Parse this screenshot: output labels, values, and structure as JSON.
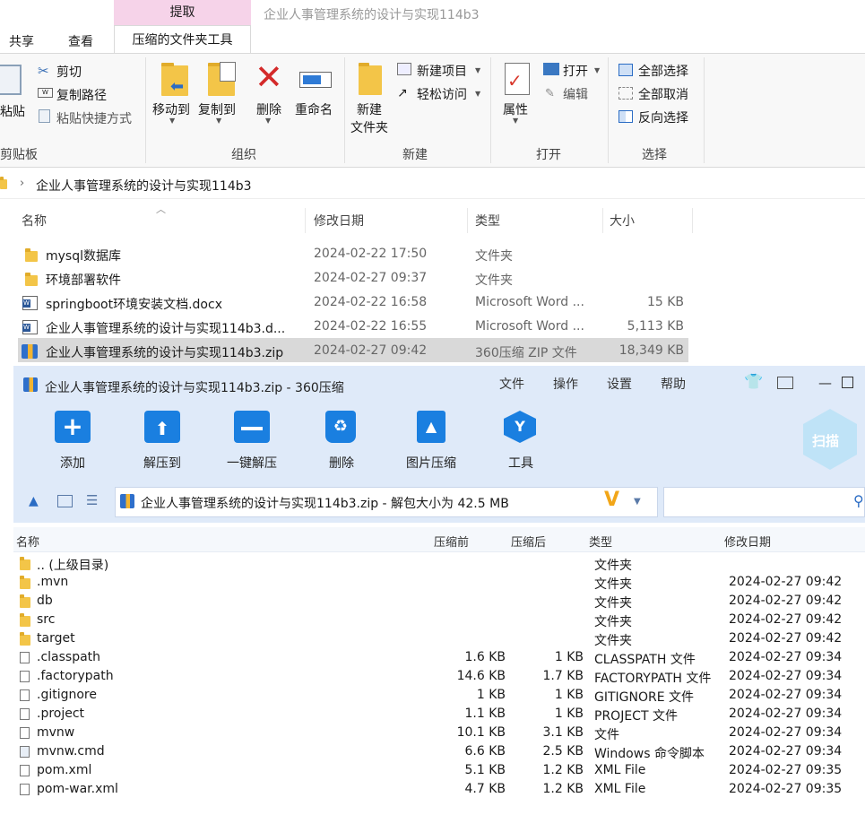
{
  "explorer": {
    "context_tab": "提取",
    "window_title": "企业人事管理系统的设计与实现114b3",
    "tabs": [
      "共享",
      "查看",
      "压缩的文件夹工具"
    ],
    "ribbon": {
      "clipboard": {
        "paste": "粘贴",
        "cut": "剪切",
        "copy_path": "复制路径",
        "paste_shortcut": "粘贴快捷方式",
        "group": "剪贴板"
      },
      "organize": {
        "move_to": "移动到",
        "copy_to": "复制到",
        "delete": "删除",
        "rename": "重命名",
        "group": "组织"
      },
      "new": {
        "new_folder_1": "新建",
        "new_folder_2": "文件夹",
        "new_item": "新建项目",
        "easy_access": "轻松访问",
        "group": "新建"
      },
      "open": {
        "properties": "属性",
        "open": "打开",
        "edit": "编辑",
        "group": "打开"
      },
      "select": {
        "select_all": "全部选择",
        "select_none": "全部取消",
        "invert": "反向选择",
        "group": "选择"
      }
    },
    "breadcrumb": "企业人事管理系统的设计与实现114b3",
    "columns": {
      "name": "名称",
      "modified": "修改日期",
      "type": "类型",
      "size": "大小"
    },
    "files": [
      {
        "name": "mysql数据库",
        "modified": "2024-02-22 17:50",
        "type": "文件夹",
        "size": "",
        "icon": "folder-icon"
      },
      {
        "name": "环境部署软件",
        "modified": "2024-02-27 09:37",
        "type": "文件夹",
        "size": "",
        "icon": "folder-icon"
      },
      {
        "name": "springboot环境安装文档.docx",
        "modified": "2024-02-22 16:58",
        "type": "Microsoft Word ...",
        "size": "15 KB",
        "icon": "word-icon"
      },
      {
        "name": "企业人事管理系统的设计与实现114b3.d...",
        "modified": "2024-02-22 16:55",
        "type": "Microsoft Word ...",
        "size": "5,113 KB",
        "icon": "word-icon"
      },
      {
        "name": "企业人事管理系统的设计与实现114b3.zip",
        "modified": "2024-02-27 09:42",
        "type": "360压缩 ZIP 文件",
        "size": "18,349 KB",
        "icon": "zip-icon"
      }
    ]
  },
  "zip360": {
    "title": "企业人事管理系统的设计与实现114b3.zip - 360压缩",
    "menu": [
      "文件",
      "操作",
      "设置",
      "帮助"
    ],
    "toolbar": [
      "添加",
      "解压到",
      "一键解压",
      "删除",
      "图片压缩",
      "工具"
    ],
    "scan_label": "扫描",
    "path": "企业人事管理系统的设计与实现114b3.zip - 解包大小为 42.5 MB",
    "columns": {
      "name": "名称",
      "before": "压缩前",
      "after": "压缩后",
      "type": "类型",
      "modified": "修改日期"
    },
    "entries": [
      {
        "name": ".. (上级目录)",
        "before": "",
        "after": "",
        "type": "文件夹",
        "modified": "",
        "icon": "folder"
      },
      {
        "name": ".mvn",
        "before": "",
        "after": "",
        "type": "文件夹",
        "modified": "2024-02-27 09:42",
        "icon": "folder"
      },
      {
        "name": "db",
        "before": "",
        "after": "",
        "type": "文件夹",
        "modified": "2024-02-27 09:42",
        "icon": "folder"
      },
      {
        "name": "src",
        "before": "",
        "after": "",
        "type": "文件夹",
        "modified": "2024-02-27 09:42",
        "icon": "folder"
      },
      {
        "name": "target",
        "before": "",
        "after": "",
        "type": "文件夹",
        "modified": "2024-02-27 09:42",
        "icon": "folder"
      },
      {
        "name": ".classpath",
        "before": "1.6 KB",
        "after": "1 KB",
        "type": "CLASSPATH 文件",
        "modified": "2024-02-27 09:34",
        "icon": "file"
      },
      {
        "name": ".factorypath",
        "before": "14.6 KB",
        "after": "1.7 KB",
        "type": "FACTORYPATH 文件",
        "modified": "2024-02-27 09:34",
        "icon": "file"
      },
      {
        "name": ".gitignore",
        "before": "1 KB",
        "after": "1 KB",
        "type": "GITIGNORE 文件",
        "modified": "2024-02-27 09:34",
        "icon": "file"
      },
      {
        "name": ".project",
        "before": "1.1 KB",
        "after": "1 KB",
        "type": "PROJECT 文件",
        "modified": "2024-02-27 09:34",
        "icon": "file"
      },
      {
        "name": "mvnw",
        "before": "10.1 KB",
        "after": "3.1 KB",
        "type": "文件",
        "modified": "2024-02-27 09:34",
        "icon": "file"
      },
      {
        "name": "mvnw.cmd",
        "before": "6.6 KB",
        "after": "2.5 KB",
        "type": "Windows 命令脚本",
        "modified": "2024-02-27 09:34",
        "icon": "cmd"
      },
      {
        "name": "pom.xml",
        "before": "5.1 KB",
        "after": "1.2 KB",
        "type": "XML File",
        "modified": "2024-02-27 09:35",
        "icon": "file"
      },
      {
        "name": "pom-war.xml",
        "before": "4.7 KB",
        "after": "1.2 KB",
        "type": "XML File",
        "modified": "2024-02-27 09:35",
        "icon": "file"
      }
    ]
  }
}
